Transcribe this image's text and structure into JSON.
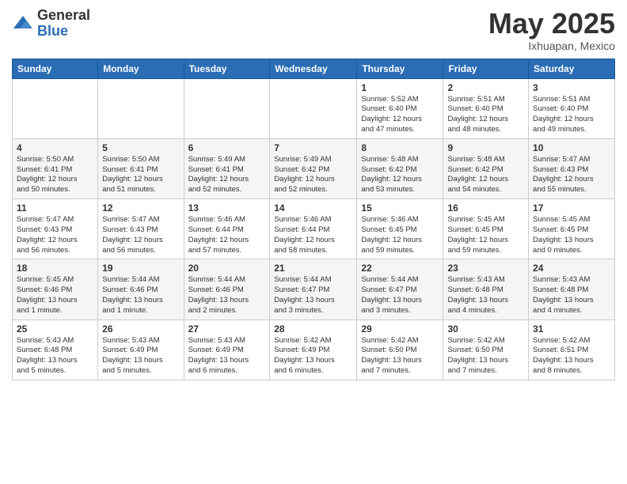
{
  "logo": {
    "general": "General",
    "blue": "Blue"
  },
  "header": {
    "month": "May 2025",
    "location": "Ixhuapan, Mexico"
  },
  "days_of_week": [
    "Sunday",
    "Monday",
    "Tuesday",
    "Wednesday",
    "Thursday",
    "Friday",
    "Saturday"
  ],
  "weeks": [
    [
      {
        "day": "",
        "info": ""
      },
      {
        "day": "",
        "info": ""
      },
      {
        "day": "",
        "info": ""
      },
      {
        "day": "",
        "info": ""
      },
      {
        "day": "1",
        "info": "Sunrise: 5:52 AM\nSunset: 6:40 PM\nDaylight: 12 hours\nand 47 minutes."
      },
      {
        "day": "2",
        "info": "Sunrise: 5:51 AM\nSunset: 6:40 PM\nDaylight: 12 hours\nand 48 minutes."
      },
      {
        "day": "3",
        "info": "Sunrise: 5:51 AM\nSunset: 6:40 PM\nDaylight: 12 hours\nand 49 minutes."
      }
    ],
    [
      {
        "day": "4",
        "info": "Sunrise: 5:50 AM\nSunset: 6:41 PM\nDaylight: 12 hours\nand 50 minutes."
      },
      {
        "day": "5",
        "info": "Sunrise: 5:50 AM\nSunset: 6:41 PM\nDaylight: 12 hours\nand 51 minutes."
      },
      {
        "day": "6",
        "info": "Sunrise: 5:49 AM\nSunset: 6:41 PM\nDaylight: 12 hours\nand 52 minutes."
      },
      {
        "day": "7",
        "info": "Sunrise: 5:49 AM\nSunset: 6:42 PM\nDaylight: 12 hours\nand 52 minutes."
      },
      {
        "day": "8",
        "info": "Sunrise: 5:48 AM\nSunset: 6:42 PM\nDaylight: 12 hours\nand 53 minutes."
      },
      {
        "day": "9",
        "info": "Sunrise: 5:48 AM\nSunset: 6:42 PM\nDaylight: 12 hours\nand 54 minutes."
      },
      {
        "day": "10",
        "info": "Sunrise: 5:47 AM\nSunset: 6:43 PM\nDaylight: 12 hours\nand 55 minutes."
      }
    ],
    [
      {
        "day": "11",
        "info": "Sunrise: 5:47 AM\nSunset: 6:43 PM\nDaylight: 12 hours\nand 56 minutes."
      },
      {
        "day": "12",
        "info": "Sunrise: 5:47 AM\nSunset: 6:43 PM\nDaylight: 12 hours\nand 56 minutes."
      },
      {
        "day": "13",
        "info": "Sunrise: 5:46 AM\nSunset: 6:44 PM\nDaylight: 12 hours\nand 57 minutes."
      },
      {
        "day": "14",
        "info": "Sunrise: 5:46 AM\nSunset: 6:44 PM\nDaylight: 12 hours\nand 58 minutes."
      },
      {
        "day": "15",
        "info": "Sunrise: 5:46 AM\nSunset: 6:45 PM\nDaylight: 12 hours\nand 59 minutes."
      },
      {
        "day": "16",
        "info": "Sunrise: 5:45 AM\nSunset: 6:45 PM\nDaylight: 12 hours\nand 59 minutes."
      },
      {
        "day": "17",
        "info": "Sunrise: 5:45 AM\nSunset: 6:45 PM\nDaylight: 13 hours\nand 0 minutes."
      }
    ],
    [
      {
        "day": "18",
        "info": "Sunrise: 5:45 AM\nSunset: 6:46 PM\nDaylight: 13 hours\nand 1 minute."
      },
      {
        "day": "19",
        "info": "Sunrise: 5:44 AM\nSunset: 6:46 PM\nDaylight: 13 hours\nand 1 minute."
      },
      {
        "day": "20",
        "info": "Sunrise: 5:44 AM\nSunset: 6:46 PM\nDaylight: 13 hours\nand 2 minutes."
      },
      {
        "day": "21",
        "info": "Sunrise: 5:44 AM\nSunset: 6:47 PM\nDaylight: 13 hours\nand 3 minutes."
      },
      {
        "day": "22",
        "info": "Sunrise: 5:44 AM\nSunset: 6:47 PM\nDaylight: 13 hours\nand 3 minutes."
      },
      {
        "day": "23",
        "info": "Sunrise: 5:43 AM\nSunset: 6:48 PM\nDaylight: 13 hours\nand 4 minutes."
      },
      {
        "day": "24",
        "info": "Sunrise: 5:43 AM\nSunset: 6:48 PM\nDaylight: 13 hours\nand 4 minutes."
      }
    ],
    [
      {
        "day": "25",
        "info": "Sunrise: 5:43 AM\nSunset: 6:48 PM\nDaylight: 13 hours\nand 5 minutes."
      },
      {
        "day": "26",
        "info": "Sunrise: 5:43 AM\nSunset: 6:49 PM\nDaylight: 13 hours\nand 5 minutes."
      },
      {
        "day": "27",
        "info": "Sunrise: 5:43 AM\nSunset: 6:49 PM\nDaylight: 13 hours\nand 6 minutes."
      },
      {
        "day": "28",
        "info": "Sunrise: 5:42 AM\nSunset: 6:49 PM\nDaylight: 13 hours\nand 6 minutes."
      },
      {
        "day": "29",
        "info": "Sunrise: 5:42 AM\nSunset: 6:50 PM\nDaylight: 13 hours\nand 7 minutes."
      },
      {
        "day": "30",
        "info": "Sunrise: 5:42 AM\nSunset: 6:50 PM\nDaylight: 13 hours\nand 7 minutes."
      },
      {
        "day": "31",
        "info": "Sunrise: 5:42 AM\nSunset: 6:51 PM\nDaylight: 13 hours\nand 8 minutes."
      }
    ]
  ]
}
